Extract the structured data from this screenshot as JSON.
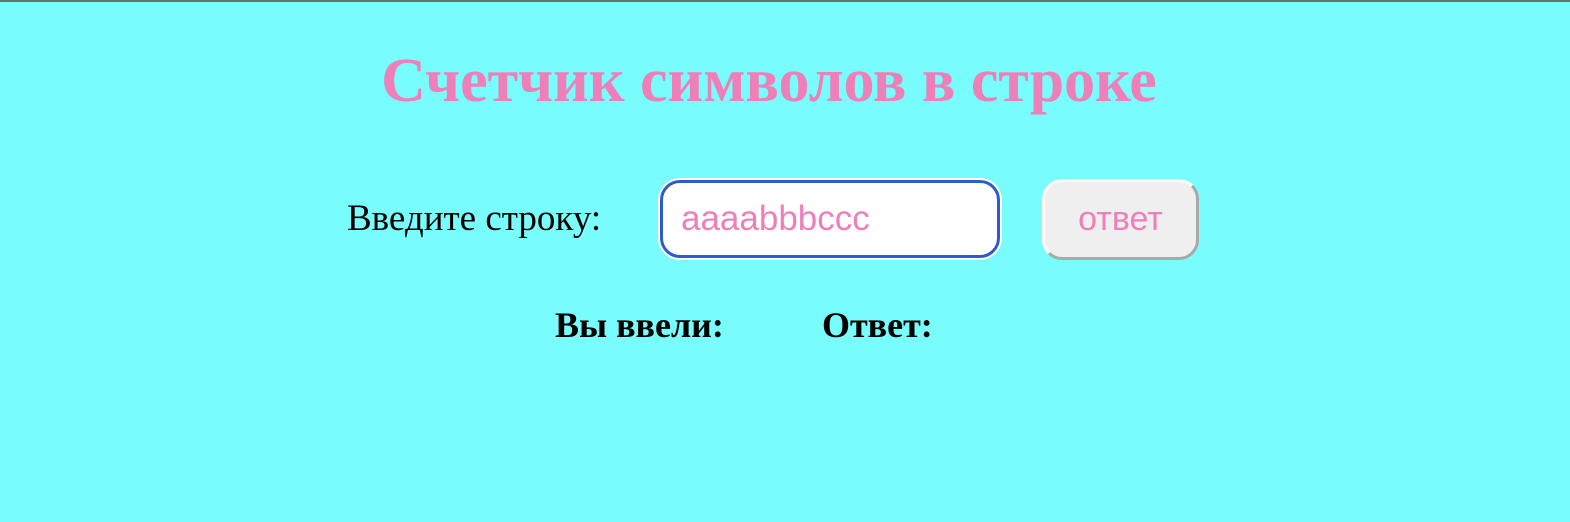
{
  "page": {
    "title": "Счетчик символов в строке"
  },
  "form": {
    "prompt_label": "Введите строку:",
    "input_value": "aaaabbbccc",
    "submit_label": "ответ"
  },
  "results": {
    "entered_label": "Вы ввели:",
    "answer_label": "Ответ:"
  },
  "colors": {
    "background": "#78fcfc",
    "accent_pink": "#ee7fb8",
    "input_focus_border": "#2f5ccc"
  }
}
